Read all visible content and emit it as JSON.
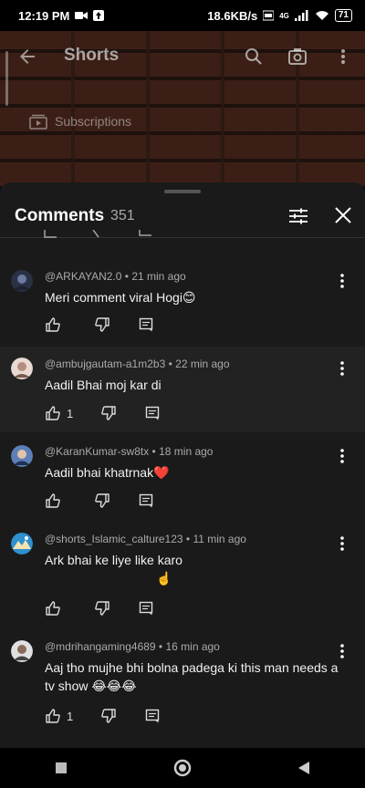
{
  "status_bar": {
    "time": "12:19 PM",
    "network_speed": "18.6KB/s",
    "network_type": "4G",
    "battery": "71"
  },
  "video_header": {
    "title": "Shorts",
    "subscriptions_label": "Subscriptions"
  },
  "comments_panel": {
    "title": "Comments",
    "count": "351"
  },
  "comments": [
    {
      "author": "@ARKAYAN2.0",
      "time": "21 min ago",
      "text": "Meri comment viral Hogi😊",
      "likes": "",
      "avatar_color": "#3b4a6b"
    },
    {
      "author": "@ambujgautam-a1m2b3",
      "time": "22 min ago",
      "text": "Aadil Bhai moj kar di",
      "likes": "1",
      "avatar_color": "#c9a89a"
    },
    {
      "author": "@KaranKumar-sw8tx",
      "time": "18 min ago",
      "text": "Aadil bhai khatrnak❤️",
      "likes": "",
      "avatar_color": "#4a6fa5"
    },
    {
      "author": "@shorts_Islamic_calture123",
      "time": "11 min ago",
      "text": "Ark bhai ke liye like karo",
      "text2": "☝️",
      "likes": "",
      "avatar_color": "#2f8fcf"
    },
    {
      "author": "@mdrihangaming4689",
      "time": "16 min ago",
      "text": "Aaj tho mujhe bhi bolna padega ki this man needs a tv show 😂😂😂",
      "likes": "1",
      "avatar_color": "#d8d8d8"
    }
  ],
  "colors": {
    "sheet_bg": "#1a1a1a",
    "heart": "#e0245e",
    "text_secondary": "#aaaaaa"
  },
  "icons": [
    "back-icon",
    "search-icon",
    "camera-icon",
    "more-vert-icon",
    "filter-icon",
    "close-icon",
    "thumb-up-icon",
    "thumb-down-icon",
    "reply-icon",
    "nav-square-icon",
    "nav-circle-icon",
    "nav-back-triangle-icon"
  ]
}
